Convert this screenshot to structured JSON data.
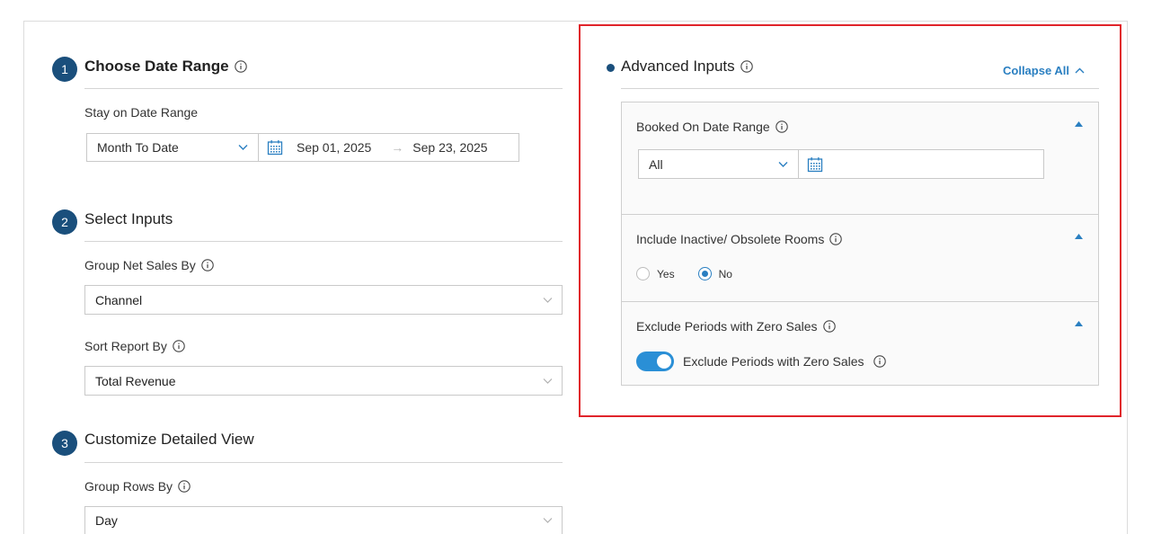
{
  "steps": [
    {
      "number": "1",
      "title": "Choose Date Range"
    },
    {
      "number": "2",
      "title": "Select Inputs"
    },
    {
      "number": "3",
      "title": "Customize Detailed View"
    }
  ],
  "date_range": {
    "label": "Stay on Date Range",
    "preset": "Month To Date",
    "start": "Sep 01, 2025",
    "arrow": "→",
    "end": "Sep 23, 2025"
  },
  "inputs": {
    "group_net_sales_label": "Group Net Sales By",
    "group_net_sales_value": "Channel",
    "sort_report_label": "Sort Report By",
    "sort_report_value": "Total Revenue"
  },
  "detailed_view": {
    "group_rows_label": "Group Rows By",
    "group_rows_value": "Day"
  },
  "advanced": {
    "title": "Advanced Inputs",
    "collapse_all": "Collapse All",
    "booked_on": {
      "title": "Booked On Date Range",
      "value": "All"
    },
    "inactive_rooms": {
      "title": "Include Inactive/ Obsolete Rooms",
      "options": [
        "Yes",
        "No"
      ],
      "selected": "No"
    },
    "zero_sales": {
      "title": "Exclude Periods with Zero Sales",
      "toggle_label": "Exclude Periods with Zero Sales",
      "enabled": true
    }
  },
  "colors": {
    "accent": "#2a7fc1",
    "step_badge": "#1a4f7c",
    "highlight_border": "#e0242b"
  }
}
